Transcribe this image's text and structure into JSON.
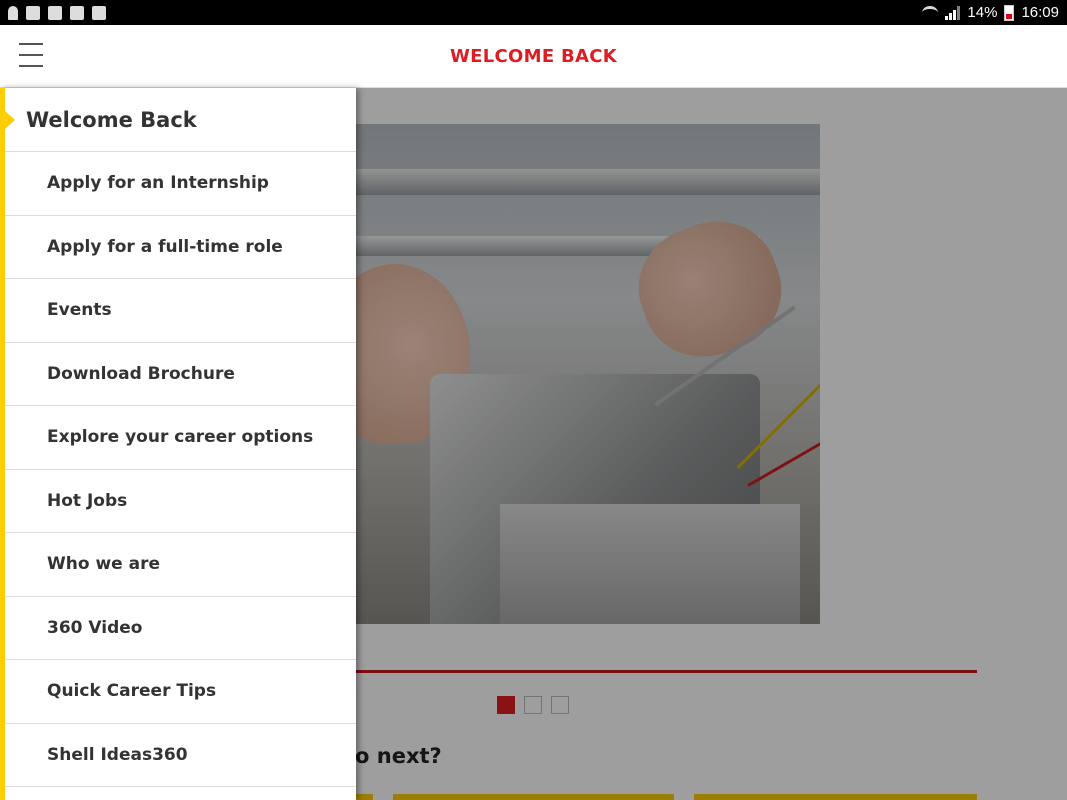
{
  "status_bar": {
    "battery": "14%",
    "time": "16:09"
  },
  "app_bar": {
    "title": "WELCOME BACK"
  },
  "main": {
    "next_heading": "do next?",
    "carousel_pages": 3,
    "carousel_active_index": 0
  },
  "drawer": {
    "header": "Welcome Back",
    "items": [
      {
        "label": "Apply for an Internship"
      },
      {
        "label": "Apply for a full-time role"
      },
      {
        "label": "Events"
      },
      {
        "label": "Download Brochure"
      },
      {
        "label": "Explore your career options"
      },
      {
        "label": "Hot Jobs"
      },
      {
        "label": "Who we are"
      },
      {
        "label": "360 Video"
      },
      {
        "label": "Quick Career Tips"
      },
      {
        "label": "Shell Ideas360"
      }
    ]
  },
  "colors": {
    "brand_red": "#dd1d21",
    "brand_yellow": "#fbce07"
  }
}
